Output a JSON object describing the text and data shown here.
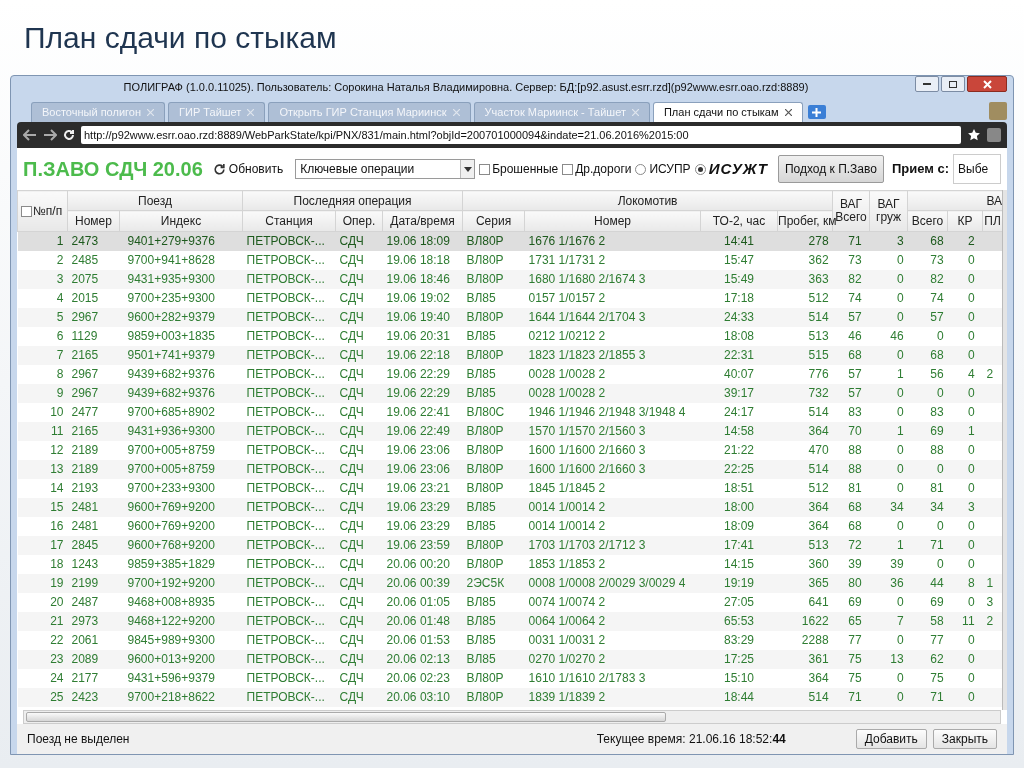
{
  "slide_title": "План сдачи по стыкам",
  "window": {
    "title": "ПОЛИГРАФ (1.0.0.11025). Пользователь: Сорокина Наталья Владимировна. Сервер: БД:[p92.asust.esrr.rzd](p92www.esrr.oao.rzd:8889)"
  },
  "tabs": [
    {
      "label": "Восточный полигон",
      "selected": false
    },
    {
      "label": "ГИР Тайшет",
      "selected": false
    },
    {
      "label": "Открыть ГИР Станция Мариинск",
      "selected": false
    },
    {
      "label": "Участок Мариинск - Тайшет",
      "selected": false
    },
    {
      "label": "План сдачи по стыкам",
      "selected": true
    }
  ],
  "address_bar": {
    "url": "http://p92www.esrr.oao.rzd:8889/WebParkState/kpi/PNX/831/main.html?objId=200701000094&indate=21.06.2016%2015:00"
  },
  "toolbar": {
    "title": "П.ЗАВО СДЧ 20.06",
    "refresh_label": "Обновить",
    "operations_select": "Ключевые операции",
    "checkboxes": [
      {
        "label": "Брошенные",
        "checked": false
      },
      {
        "label": "Др.дороги",
        "checked": false
      }
    ],
    "radios": [
      {
        "kind": "text",
        "label": "ИСУПР",
        "selected": false
      },
      {
        "kind": "logo",
        "label": "ИСУЖТ",
        "selected": true
      }
    ],
    "approach_button": "Подход к П.Заво",
    "reception_label": "Прием с:",
    "reception_select": "Выбе"
  },
  "table": {
    "select_all_checked": false,
    "groups": [
      "Поезд",
      "Последняя операция",
      "Локомотив",
      "ВА"
    ],
    "columns": [
      "№п/п",
      "Номер",
      "Индекс",
      "Станция",
      "Опер.",
      "Дата/время",
      "Серия",
      "Номер",
      "ТО-2, час",
      "Пробег, км",
      "ВАГ Всего",
      "ВАГ груж",
      "Всего",
      "КР",
      "ПЛ"
    ],
    "rows": [
      {
        "selected": true,
        "cells": [
          "1",
          "2473",
          "9401+279+9376",
          "ПЕТРОВСК-...",
          "СДЧ",
          "19.06 18:09",
          "ВЛ80Р",
          "1676 1/1676 2",
          "14:41",
          "278",
          "71",
          "3",
          "68",
          "2"
        ]
      },
      {
        "selected": false,
        "cells": [
          "2",
          "2485",
          "9700+941+8628",
          "ПЕТРОВСК-...",
          "СДЧ",
          "19.06 18:18",
          "ВЛ80Р",
          "1731 1/1731 2",
          "15:47",
          "362",
          "73",
          "0",
          "73",
          "0"
        ]
      },
      {
        "selected": false,
        "cells": [
          "3",
          "2075",
          "9431+935+9300",
          "ПЕТРОВСК-...",
          "СДЧ",
          "19.06 18:46",
          "ВЛ80Р",
          "1680 1/1680 2/1674 3",
          "15:49",
          "363",
          "82",
          "0",
          "82",
          "0"
        ]
      },
      {
        "selected": false,
        "cells": [
          "4",
          "2015",
          "9700+235+9300",
          "ПЕТРОВСК-...",
          "СДЧ",
          "19.06 19:02",
          "ВЛ85",
          "0157 1/0157 2",
          "17:18",
          "512",
          "74",
          "0",
          "74",
          "0"
        ]
      },
      {
        "selected": false,
        "cells": [
          "5",
          "2967",
          "9600+282+9379",
          "ПЕТРОВСК-...",
          "СДЧ",
          "19.06 19:40",
          "ВЛ80Р",
          "1644 1/1644 2/1704 3",
          "24:33",
          "514",
          "57",
          "0",
          "57",
          "0"
        ]
      },
      {
        "selected": false,
        "cells": [
          "6",
          "1129",
          "9859+003+1835",
          "ПЕТРОВСК-...",
          "СДЧ",
          "19.06 20:31",
          "ВЛ85",
          "0212 1/0212 2",
          "18:08",
          "513",
          "46",
          "46",
          "0",
          "0"
        ]
      },
      {
        "selected": false,
        "cells": [
          "7",
          "2165",
          "9501+741+9379",
          "ПЕТРОВСК-...",
          "СДЧ",
          "19.06 22:18",
          "ВЛ80Р",
          "1823 1/1823 2/1855 3",
          "22:31",
          "515",
          "68",
          "0",
          "68",
          "0"
        ]
      },
      {
        "selected": false,
        "cells": [
          "8",
          "2967",
          "9439+682+9376",
          "ПЕТРОВСК-...",
          "СДЧ",
          "19.06 22:29",
          "ВЛ85",
          "0028 1/0028 2",
          "40:07",
          "776",
          "57",
          "1",
          "56",
          "4",
          "2"
        ]
      },
      {
        "selected": false,
        "cells": [
          "9",
          "2967",
          "9439+682+9376",
          "ПЕТРОВСК-...",
          "СДЧ",
          "19.06 22:29",
          "ВЛ85",
          "0028 1/0028 2",
          "39:17",
          "732",
          "57",
          "0",
          "0",
          "0"
        ]
      },
      {
        "selected": false,
        "cells": [
          "10",
          "2477",
          "9700+685+8902",
          "ПЕТРОВСК-...",
          "СДЧ",
          "19.06 22:41",
          "ВЛ80С",
          "1946 1/1946 2/1948 3/1948 4",
          "24:17",
          "514",
          "83",
          "0",
          "83",
          "0"
        ]
      },
      {
        "selected": false,
        "cells": [
          "11",
          "2165",
          "9431+936+9300",
          "ПЕТРОВСК-...",
          "СДЧ",
          "19.06 22:49",
          "ВЛ80Р",
          "1570 1/1570 2/1560 3",
          "14:58",
          "364",
          "70",
          "1",
          "69",
          "1"
        ]
      },
      {
        "selected": false,
        "cells": [
          "12",
          "2189",
          "9700+005+8759",
          "ПЕТРОВСК-...",
          "СДЧ",
          "19.06 23:06",
          "ВЛ80Р",
          "1600 1/1600 2/1660 3",
          "21:22",
          "470",
          "88",
          "0",
          "88",
          "0"
        ]
      },
      {
        "selected": false,
        "cells": [
          "13",
          "2189",
          "9700+005+8759",
          "ПЕТРОВСК-...",
          "СДЧ",
          "19.06 23:06",
          "ВЛ80Р",
          "1600 1/1600 2/1660 3",
          "22:25",
          "514",
          "88",
          "0",
          "0",
          "0"
        ]
      },
      {
        "selected": false,
        "cells": [
          "14",
          "2193",
          "9700+233+9300",
          "ПЕТРОВСК-...",
          "СДЧ",
          "19.06 23:21",
          "ВЛ80Р",
          "1845 1/1845 2",
          "18:51",
          "512",
          "81",
          "0",
          "81",
          "0"
        ]
      },
      {
        "selected": false,
        "cells": [
          "15",
          "2481",
          "9600+769+9200",
          "ПЕТРОВСК-...",
          "СДЧ",
          "19.06 23:29",
          "ВЛ85",
          "0014 1/0014 2",
          "18:00",
          "364",
          "68",
          "34",
          "34",
          "3"
        ]
      },
      {
        "selected": false,
        "cells": [
          "16",
          "2481",
          "9600+769+9200",
          "ПЕТРОВСК-...",
          "СДЧ",
          "19.06 23:29",
          "ВЛ85",
          "0014 1/0014 2",
          "18:09",
          "364",
          "68",
          "0",
          "0",
          "0"
        ]
      },
      {
        "selected": false,
        "cells": [
          "17",
          "2845",
          "9600+768+9200",
          "ПЕТРОВСК-...",
          "СДЧ",
          "19.06 23:59",
          "ВЛ80Р",
          "1703 1/1703 2/1712 3",
          "17:41",
          "513",
          "72",
          "1",
          "71",
          "0"
        ]
      },
      {
        "selected": false,
        "cells": [
          "18",
          "1243",
          "9859+385+1829",
          "ПЕТРОВСК-...",
          "СДЧ",
          "20.06 00:20",
          "ВЛ80Р",
          "1853 1/1853 2",
          "14:15",
          "360",
          "39",
          "39",
          "0",
          "0"
        ]
      },
      {
        "selected": false,
        "cells": [
          "19",
          "2199",
          "9700+192+9200",
          "ПЕТРОВСК-...",
          "СДЧ",
          "20.06 00:39",
          "2ЭС5К",
          "0008 1/0008 2/0029 3/0029 4",
          "19:19",
          "365",
          "80",
          "36",
          "44",
          "8",
          "1"
        ]
      },
      {
        "selected": false,
        "cells": [
          "20",
          "2487",
          "9468+008+8935",
          "ПЕТРОВСК-...",
          "СДЧ",
          "20.06 01:05",
          "ВЛ85",
          "0074 1/0074 2",
          "27:05",
          "641",
          "69",
          "0",
          "69",
          "0",
          "3"
        ]
      },
      {
        "selected": false,
        "cells": [
          "21",
          "2973",
          "9468+122+9200",
          "ПЕТРОВСК-...",
          "СДЧ",
          "20.06 01:48",
          "ВЛ85",
          "0064 1/0064 2",
          "65:53",
          "1622",
          "65",
          "7",
          "58",
          "11",
          "2"
        ]
      },
      {
        "selected": false,
        "cells": [
          "22",
          "2061",
          "9845+989+9300",
          "ПЕТРОВСК-...",
          "СДЧ",
          "20.06 01:53",
          "ВЛ85",
          "0031 1/0031 2",
          "83:29",
          "2288",
          "77",
          "0",
          "77",
          "0"
        ]
      },
      {
        "selected": false,
        "cells": [
          "23",
          "2089",
          "9600+013+9200",
          "ПЕТРОВСК-...",
          "СДЧ",
          "20.06 02:13",
          "ВЛ85",
          "0270 1/0270 2",
          "17:25",
          "361",
          "75",
          "13",
          "62",
          "0"
        ]
      },
      {
        "selected": false,
        "cells": [
          "24",
          "2177",
          "9431+596+9379",
          "ПЕТРОВСК-...",
          "СДЧ",
          "20.06 02:23",
          "ВЛ80Р",
          "1610 1/1610 2/1783 3",
          "15:10",
          "364",
          "75",
          "0",
          "75",
          "0"
        ]
      },
      {
        "selected": false,
        "cells": [
          "25",
          "2423",
          "9700+218+8622",
          "ПЕТРОВСК-...",
          "СДЧ",
          "20.06 03:10",
          "ВЛ80Р",
          "1839 1/1839 2",
          "18:44",
          "514",
          "71",
          "0",
          "71",
          "0"
        ]
      }
    ]
  },
  "status_bar": {
    "message": "Поезд не выделен",
    "time": "Текущее время: 21.06.16 18:52:**44**",
    "buttons": [
      "Добавить",
      "Закрыть"
    ]
  }
}
